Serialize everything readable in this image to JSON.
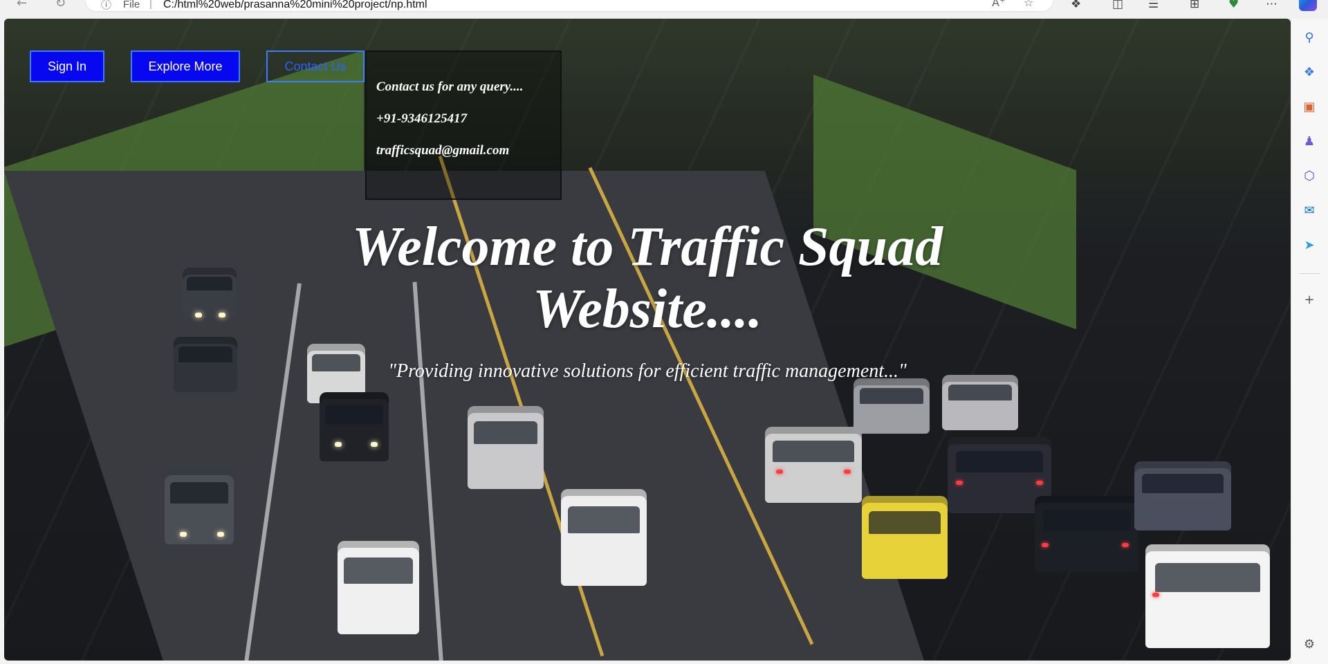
{
  "browser": {
    "file_label": "File",
    "separator": "|",
    "url": "C:/html%20web/prasanna%20mini%20project/np.html"
  },
  "page": {
    "nav": {
      "sign_in": "Sign In",
      "explore_more": "Explore More",
      "contact_us": "Contact Us"
    },
    "contact": {
      "heading": "Contact us for any query....",
      "phone": "+91-9346125417",
      "email": "trafficsquad@gmail.com"
    },
    "headline_line1": "Welcome to Traffic Squad",
    "headline_line2": "Website....",
    "tagline": "\"Providing innovative solutions for efficient traffic management...\""
  },
  "icons": {
    "toolbar": [
      "back-icon",
      "refresh-icon",
      "info-icon",
      "read-aloud-icon",
      "favorite-star-icon",
      "extensions-icon",
      "split-screen-icon",
      "favorites-icon",
      "collections-icon",
      "browser-essentials-icon",
      "more-icon",
      "copilot-icon"
    ],
    "sidebar": [
      "search-icon",
      "shopping-tag-icon",
      "tools-icon",
      "games-icon",
      "microsoft365-icon",
      "outlook-icon",
      "telegram-icon",
      "add-icon",
      "settings-icon"
    ]
  },
  "colors": {
    "button_solid": "#0707f0",
    "button_border": "#3b7dff",
    "text_white": "#ffffff"
  }
}
